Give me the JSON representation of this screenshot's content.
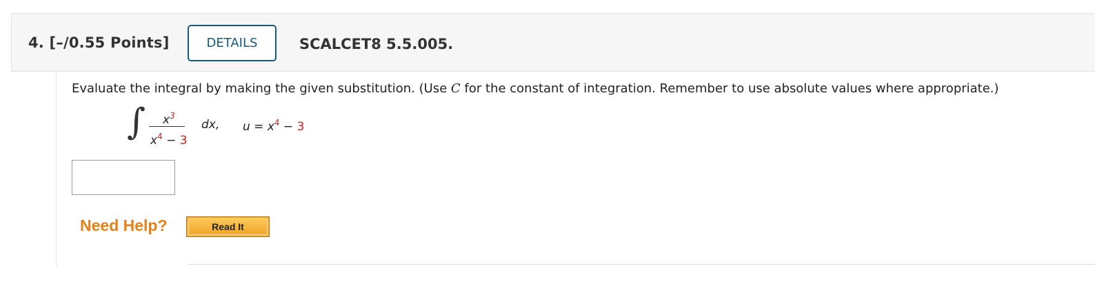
{
  "question": {
    "number_points": "4. [–/0.55 Points]",
    "details_label": "DETAILS",
    "code": "SCALCET8 5.5.005."
  },
  "prompt": {
    "before_c": "Evaluate the integral by making the given substitution. (Use ",
    "c_symbol": "C",
    "after_c": " for the constant of integration. Remember to use absolute values where appropriate.)"
  },
  "math": {
    "integral_sign": "∫",
    "numerator_var": "x",
    "numerator_exp": "3",
    "denominator_var": "x",
    "denominator_exp": "4",
    "denominator_minus": " − ",
    "denominator_const": "3",
    "dx": "dx,",
    "sub_lhs": "u = x",
    "sub_exp": "4",
    "sub_minus": " − ",
    "sub_const": "3"
  },
  "answer": {
    "value": ""
  },
  "help": {
    "need_help_label": "Need Help?",
    "read_it_label": "Read It"
  },
  "colors": {
    "accent": "#135a7a",
    "help_orange": "#e8801a",
    "highlight_red": "#cc1f1f"
  }
}
